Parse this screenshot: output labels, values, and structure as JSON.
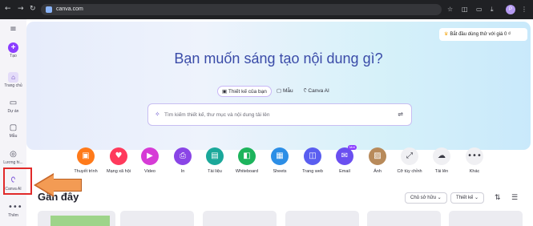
{
  "browser": {
    "url": "canva.com",
    "back_icon": "arrow-left-icon",
    "forward_icon": "arrow-right-icon",
    "reload_icon": "reload-icon",
    "profile_initial": "P"
  },
  "sidebar": {
    "items": [
      {
        "label": "",
        "icon": "menu-icon"
      },
      {
        "label": "Tạo",
        "icon": "plus-icon"
      },
      {
        "label": "Trang chủ",
        "icon": "home-icon"
      },
      {
        "label": "Dự án",
        "icon": "folder-icon"
      },
      {
        "label": "Mẫu",
        "icon": "template-icon"
      },
      {
        "label": "Thương hiệu",
        "icon": "brand-icon"
      },
      {
        "label": "Canva AI",
        "icon": "canva-ai-icon"
      },
      {
        "label": "Thêm",
        "icon": "more-icon"
      }
    ],
    "truncated_brand_label": "Lương hi..."
  },
  "hero": {
    "promo": "Bắt đầu dùng thử với giá 0 ₫",
    "title": "Bạn muốn sáng tạo nội dung gì?",
    "tabs": [
      {
        "label": "Thiết kế của bạn",
        "icon": "design-icon",
        "active": true
      },
      {
        "label": "Mẫu",
        "icon": "template-icon",
        "active": false
      },
      {
        "label": "Canva AI",
        "icon": "canva-ai-icon",
        "active": false
      }
    ],
    "search_placeholder": "Tìm kiếm thiết kế, thư mục và nội dung tải lên"
  },
  "shortcuts": [
    {
      "label": "Thuyết trình",
      "color": "#ff7a1a",
      "icon": "presentation-icon"
    },
    {
      "label": "Mạng xã hội",
      "color": "#ff3a5c",
      "icon": "heart-icon"
    },
    {
      "label": "Video",
      "color": "#d63bd6",
      "icon": "play-icon"
    },
    {
      "label": "In",
      "color": "#8a45e6",
      "icon": "print-icon"
    },
    {
      "label": "Tài liệu",
      "color": "#1ba89a",
      "icon": "document-icon"
    },
    {
      "label": "Whiteboard",
      "color": "#1db45c",
      "icon": "whiteboard-icon"
    },
    {
      "label": "Sheets",
      "color": "#2c8ee6",
      "icon": "sheets-icon"
    },
    {
      "label": "Trang web",
      "color": "#5a5ef0",
      "icon": "website-icon"
    },
    {
      "label": "Email",
      "color": "#6a4ff0",
      "icon": "email-icon",
      "badge": "Mới"
    },
    {
      "label": "Ảnh",
      "color": "#b88a5a",
      "icon": "photo-icon"
    },
    {
      "label": "Cỡ tùy chỉnh",
      "color": "#f0f0f3",
      "icon": "resize-icon"
    },
    {
      "label": "Tải lên",
      "color": "#f0f0f3",
      "icon": "upload-icon"
    },
    {
      "label": "Khác",
      "color": "#f0f0f3",
      "icon": "more-icon"
    }
  ],
  "recent": {
    "title": "Gần đây",
    "owner_filter": "Chủ sở hữu",
    "type_filter": "Thiết kế",
    "sort_icon": "sort-icon",
    "view_icon": "list-view-icon"
  }
}
